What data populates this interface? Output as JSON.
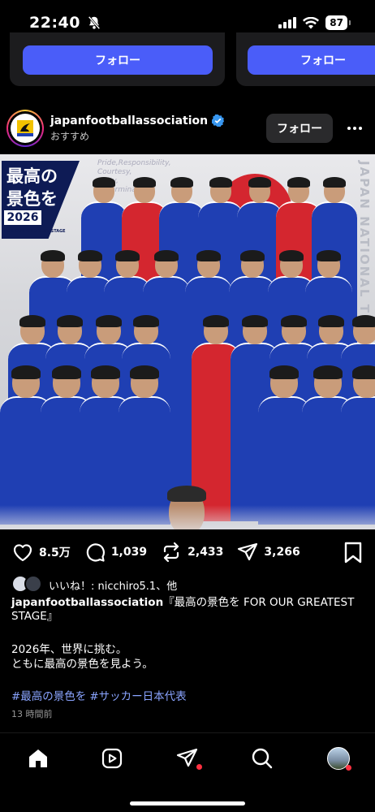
{
  "status_bar": {
    "time": "22:40",
    "battery": "87",
    "icons": [
      "bell-off-icon",
      "signal-icon",
      "wifi-icon",
      "battery-icon"
    ]
  },
  "suggestions": {
    "follow_label_1": "フォロー",
    "follow_label_2": "フォロー"
  },
  "post": {
    "username": "japanfootballassociation",
    "subtitle": "おすすめ",
    "follow_label": "フォロー",
    "image": {
      "headline_line1": "最高の",
      "headline_line2": "景色を",
      "headline_year": "2026",
      "tagline": "FOR OUR GREATEST STAGE",
      "motto_1": "Pride,Responsibility,",
      "motto_2": "Courtesy,",
      "motto_3": "Unity,",
      "motto_4": "Determination",
      "vertical_text": "JAPAN NATIONAL TEAM",
      "accent_blue": "#1f3fb3",
      "accent_red": "#d4262f"
    },
    "actions": {
      "likes": "8.5万",
      "comments": "1,039",
      "reposts": "2,433",
      "shares": "3,266"
    },
    "liked_by": "いいね！: nicchiro5.1、他",
    "caption_user": "japanfootballassociation",
    "caption_title_line1": "『最高の景色を FOR OUR GREATEST",
    "caption_title_line2": "STAGE』",
    "body_line1": "2026年、世界に挑む。",
    "body_line2": "ともに最高の景色を見よう。",
    "hashtag1": "#最高の景色を",
    "hashtag2": "#サッカー日本代表",
    "time_ago": "13 時間前"
  },
  "nav": {
    "items": [
      "home-icon",
      "reels-icon",
      "messages-icon",
      "search-icon",
      "profile-avatar"
    ]
  }
}
